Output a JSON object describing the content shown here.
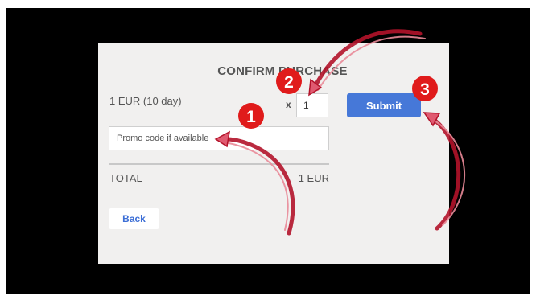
{
  "dialog": {
    "title": "CONFIRM PURCHASE",
    "item_label": "1 EUR (10 day)",
    "quantity_prefix": "x",
    "quantity_value": "1",
    "submit_label": "Submit",
    "promo_placeholder": "Promo code if available",
    "total_label": "TOTAL",
    "total_value": "1 EUR",
    "back_label": "Back"
  },
  "annotations": {
    "badges": [
      "1",
      "2",
      "3"
    ],
    "badge_color": "#e01b1b",
    "arrow_color": "#b3132a"
  },
  "colors": {
    "background": "#000000",
    "dialog_bg": "#f1f0ef",
    "accent": "#4678d8"
  }
}
